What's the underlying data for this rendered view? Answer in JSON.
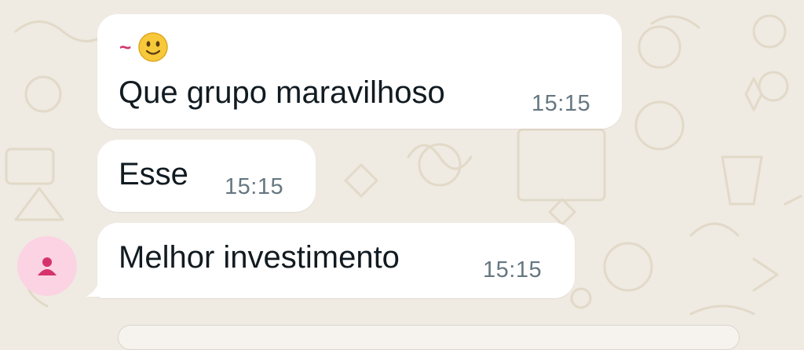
{
  "chat": {
    "messages": [
      {
        "sender_prefix": "~",
        "sender_emoji": "slightly-smiling-face-emoji",
        "text": "Que grupo maravilhoso",
        "time": "15:15"
      },
      {
        "text": "Esse",
        "time": "15:15"
      },
      {
        "text": "Melhor investimento",
        "time": "15:15",
        "avatar_icon": "person-icon"
      }
    ]
  },
  "colors": {
    "background": "#efeae2",
    "bubble": "#ffffff",
    "sender_accent": "#d6336c",
    "avatar_bg": "#fbd3e3",
    "time_text": "#667781"
  }
}
